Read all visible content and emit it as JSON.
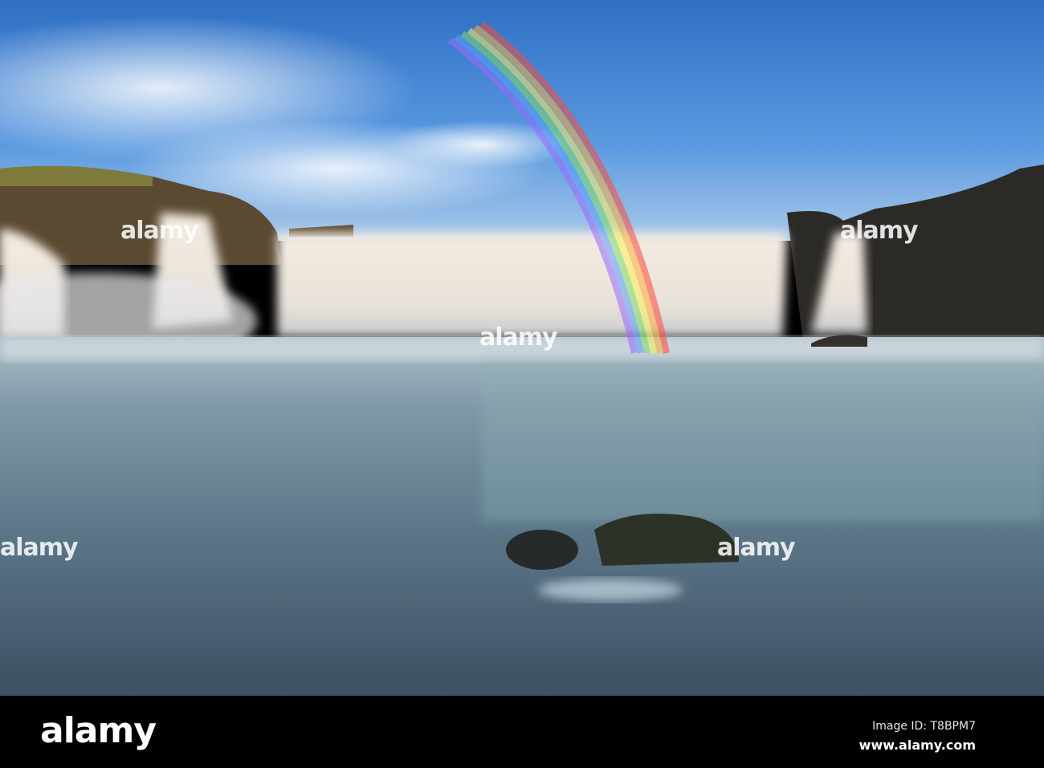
{
  "watermark": {
    "logo_text": "alamy"
  },
  "footer": {
    "logo": "alamy",
    "image_id": "Image ID: T8BPM7",
    "url": "www.alamy.com"
  }
}
